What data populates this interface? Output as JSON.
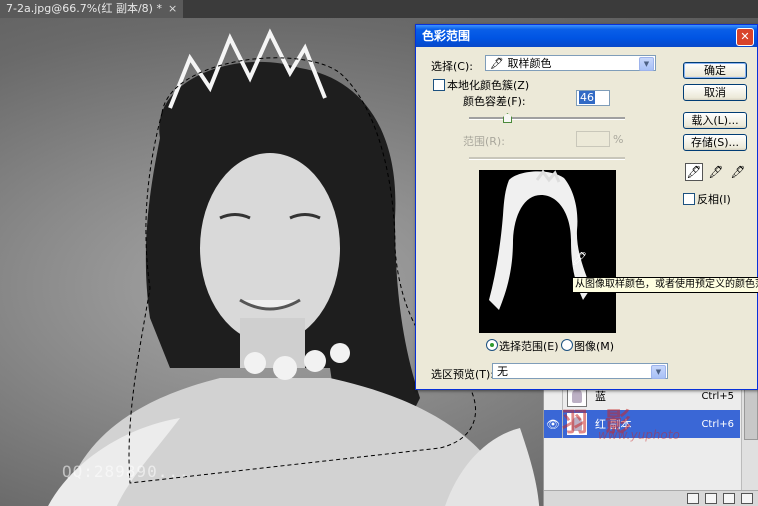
{
  "document_tab": {
    "title": "7-2a.jpg@66.7%(红 副本/8) *",
    "close_glyph": "×"
  },
  "watermark": "QQ:289890...",
  "dialog": {
    "title": "色彩范围",
    "close_glyph": "✕",
    "select_label": "选择(C):",
    "select_icon": "eyedropper-icon",
    "select_value": "取样颜色",
    "localized_clusters_label": "本地化颜色簇(Z)",
    "localized_clusters_checked": false,
    "fuzziness_label": "颜色容差(F):",
    "fuzziness_value": "46",
    "range_label": "范围(R):",
    "range_value": "",
    "range_unit": "%",
    "radio_selection_label": "选择范围(E)",
    "radio_image_label": "图像(M)",
    "radio_selected": "selection",
    "selection_preview_label": "选区预览(T):",
    "selection_preview_value": "无",
    "buttons": {
      "ok": "确定",
      "cancel": "取消",
      "load": "载入(L)...",
      "save": "存储(S)..."
    },
    "invert_label": "反相(I)",
    "invert_checked": false,
    "tooltip": "从图像取样颜色，或者使用预定义的颜色范围"
  },
  "layers": [
    {
      "name": "蓝",
      "shortcut": "Ctrl+5",
      "visible": false,
      "selected": false
    },
    {
      "name": "红 副本",
      "shortcut": "Ctrl+6",
      "visible": true,
      "selected": true
    }
  ],
  "layers_watermark": {
    "main": "羽 影",
    "sub": "www.yuphoto"
  },
  "colors": {
    "titlebar": "#0054e3",
    "dialog_bg": "#ece9d8",
    "selected_layer": "#3a67d6"
  }
}
